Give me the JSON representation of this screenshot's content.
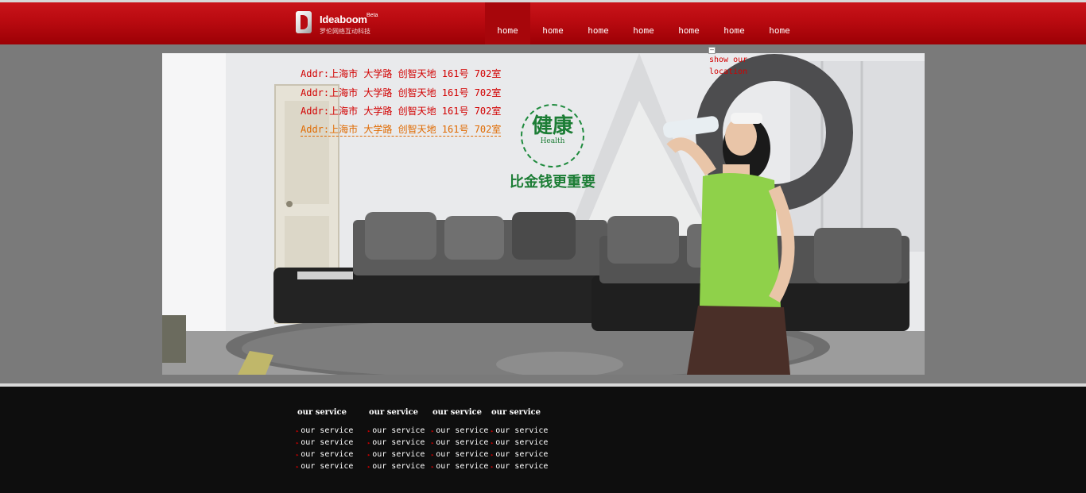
{
  "header": {
    "logo_name": "Ideaboom",
    "logo_sub": "罗伦网络互动科技",
    "logo_badge": "Beta",
    "nav": [
      "home",
      "home",
      "home",
      "home",
      "home",
      "home",
      "home"
    ]
  },
  "hero": {
    "addresses": [
      "Addr:上海市 大学路 创智天地 161号 702室",
      "Addr:上海市 大学路 创智天地 161号 702室",
      "Addr:上海市 大学路 创智天地 161号 702室",
      "Addr:上海市 大学路 创智天地 161号 702室"
    ],
    "badge_big": "健康",
    "badge_small": "Health",
    "slogan": "比金钱更重要"
  },
  "location_toggle": {
    "toggle_symbol": "—",
    "label": "show our location"
  },
  "footer": {
    "headings": [
      "our service",
      "our service",
      "our service",
      "our service"
    ],
    "columns": [
      [
        "our service",
        "our service",
        "our service",
        "our service"
      ],
      [
        "our service",
        "our service",
        "our service",
        "our service"
      ],
      [
        "our service",
        "our service",
        "our service",
        "our service"
      ],
      [
        "our service",
        "our service",
        "our service",
        "our service"
      ]
    ]
  },
  "colors": {
    "header_red": "#b90a10",
    "address_red": "#d20000",
    "address_active": "#e06a00",
    "health_green": "#1c7d35",
    "page_gray": "#7a7a7a",
    "footer_black": "#0e0e0e"
  }
}
